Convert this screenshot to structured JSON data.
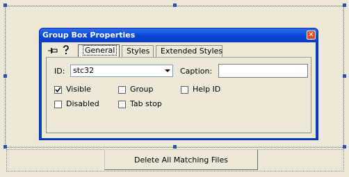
{
  "dialog": {
    "title": "Group Box Properties",
    "close_glyph": "✕",
    "tabs": [
      {
        "label": "General",
        "active": true
      },
      {
        "label": "Styles",
        "active": false
      },
      {
        "label": "Extended Styles",
        "active": false
      }
    ],
    "id_label": "ID:",
    "id_value": "stc32",
    "caption_label": "Caption:",
    "caption_value": "",
    "checkboxes": [
      {
        "label": "Visible",
        "checked": true
      },
      {
        "label": "Group",
        "checked": false
      },
      {
        "label": "Help ID",
        "checked": false
      },
      {
        "label": "Disabled",
        "checked": false
      },
      {
        "label": "Tab stop",
        "checked": false
      }
    ]
  },
  "icons": {
    "pin": "pushpin-icon",
    "help": "question-icon"
  },
  "bottom_button": {
    "label": "Delete All Matching Files"
  },
  "colors": {
    "titlebar": "#0a3ec8",
    "close": "#e2481f",
    "handle": "#2e4fb1",
    "background": "#ece9d8"
  }
}
